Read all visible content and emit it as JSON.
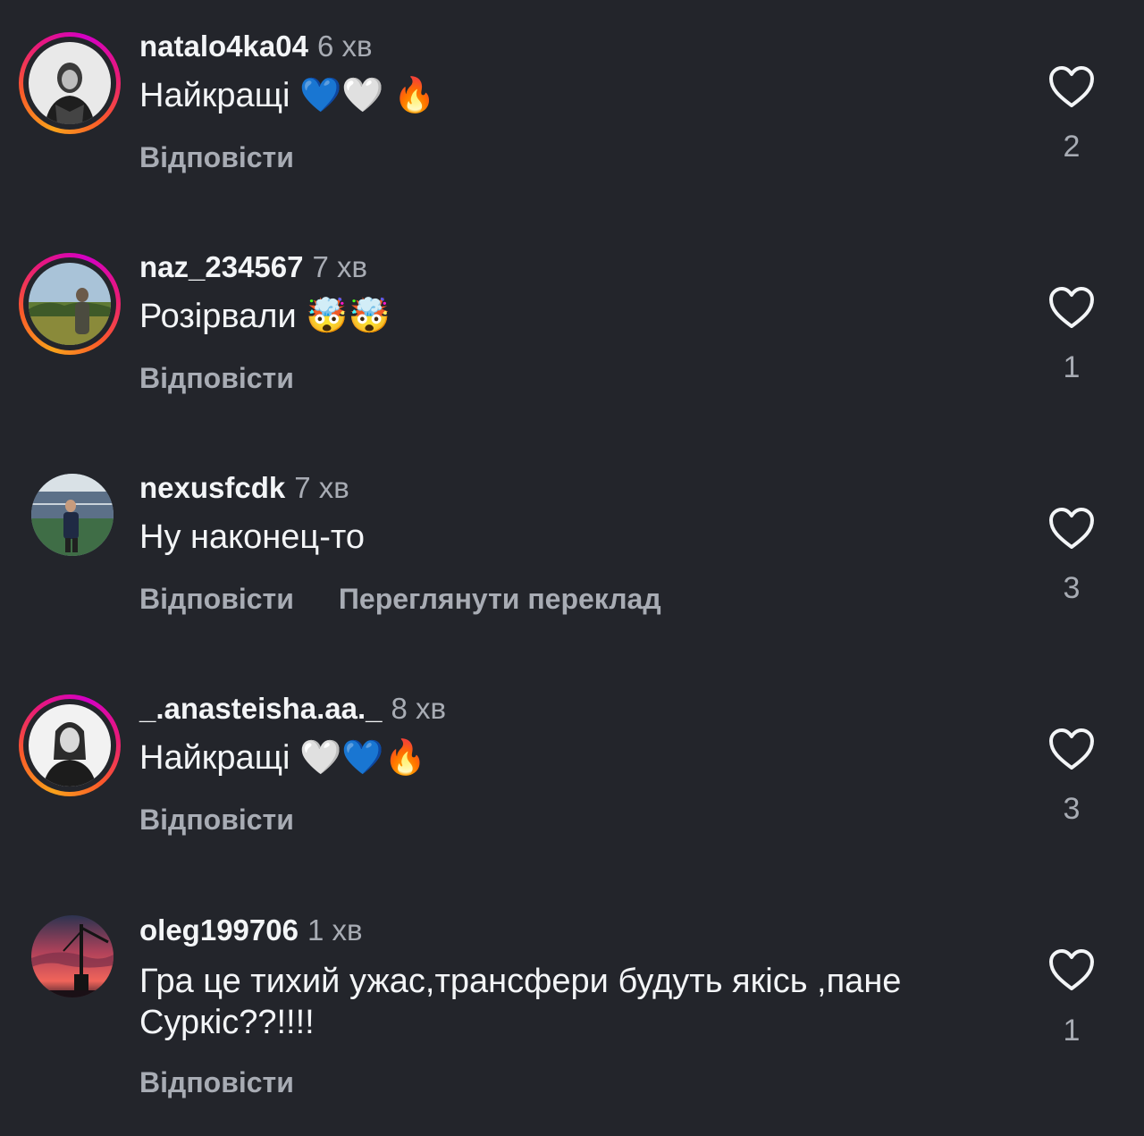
{
  "comments": [
    {
      "username": "natalo4ka04",
      "time": "6 хв",
      "text": "Найкращі 💙🤍 🔥",
      "reply_label": "Відповісти",
      "likes": "2",
      "story_ring": true
    },
    {
      "username": "naz_234567",
      "time": "7 хв",
      "text": "Розірвали 🤯🤯",
      "reply_label": "Відповісти",
      "likes": "1",
      "story_ring": true
    },
    {
      "username": "nexusfcdk",
      "time": "7 хв",
      "text": "Ну наконец-то",
      "reply_label": "Відповісти",
      "translate_label": "Переглянути переклад",
      "likes": "3",
      "story_ring": false
    },
    {
      "username": "_.anasteisha.aa._",
      "time": "8 хв",
      "text": "Найкращі 🤍💙🔥",
      "reply_label": "Відповісти",
      "likes": "3",
      "story_ring": true
    },
    {
      "username": "oleg199706",
      "time": "1 хв",
      "text": "Гра це тихий ужас,трансфери будуть якісь ,пане Суркіс??!!!!",
      "reply_label": "Відповісти",
      "likes": "1",
      "story_ring": false
    }
  ],
  "icons": {
    "like": "heart-outline-icon"
  },
  "colors": {
    "background": "#23252b",
    "primary_text": "#f3f5f7",
    "secondary_text": "#a8acb4"
  }
}
